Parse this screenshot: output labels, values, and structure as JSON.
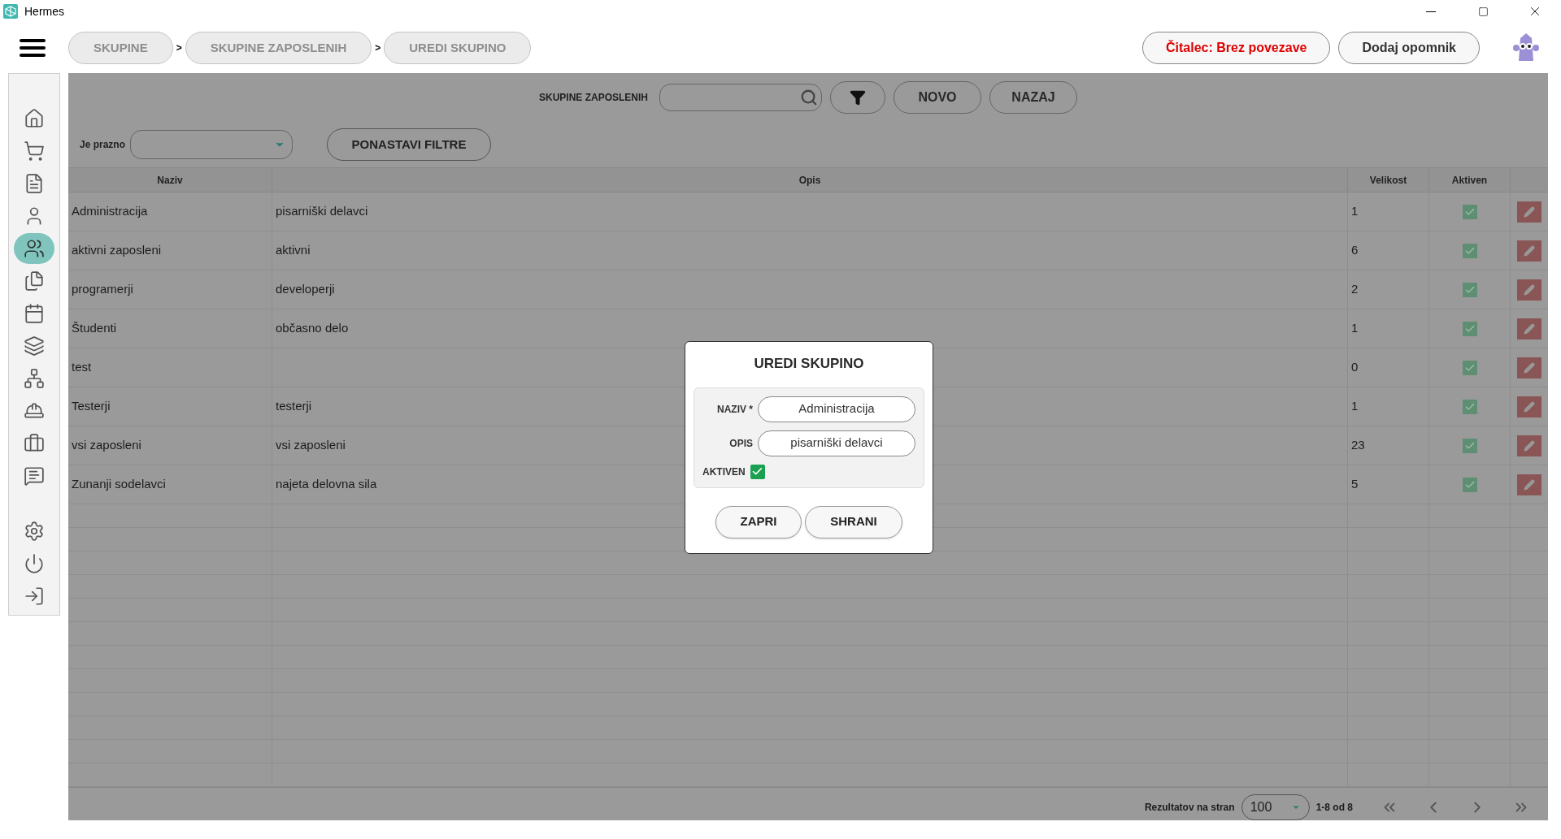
{
  "window": {
    "title": "Hermes"
  },
  "breadcrumbs": [
    {
      "label": "SKUPINE",
      "separator": ">"
    },
    {
      "label": "SKUPINE ZAPOSLENIH",
      "separator": ">"
    },
    {
      "label": "UREDI SKUPINO"
    }
  ],
  "header_buttons": [
    {
      "label": "Čitalec: Brez povezave",
      "kind": "warning"
    },
    {
      "label": "Dodaj opomnik",
      "kind": "normal"
    }
  ],
  "sidebar": {
    "items": [
      {
        "kind": "home",
        "selected": false
      },
      {
        "kind": "cart",
        "selected": false
      },
      {
        "kind": "document",
        "selected": false
      },
      {
        "kind": "person",
        "selected": false
      },
      {
        "kind": "people",
        "selected": true
      },
      {
        "kind": "pages",
        "selected": false
      },
      {
        "kind": "calendar",
        "selected": false
      },
      {
        "kind": "layers",
        "selected": false
      },
      {
        "kind": "hierarchy",
        "selected": false
      },
      {
        "kind": "worker",
        "selected": false
      },
      {
        "kind": "briefcase",
        "selected": false
      },
      {
        "kind": "message",
        "selected": false
      }
    ],
    "bottom_items": [
      {
        "kind": "settings",
        "selected": false
      },
      {
        "kind": "power",
        "selected": false
      },
      {
        "kind": "exit",
        "selected": false
      }
    ]
  },
  "toolbar": {
    "label": "SKUPINE ZAPOSLENIH",
    "buttons": [
      "NOVO",
      "NAZAJ"
    ]
  },
  "filters": {
    "label": "Je prazno",
    "reset_button": "PONASTAVI FILTRE"
  },
  "table": {
    "columns": [
      "Naziv",
      "Opis",
      "Velikost",
      "Aktiven"
    ],
    "rows": [
      {
        "naziv": "Administracija",
        "opis": "pisarniški delavci",
        "velikost": "1",
        "aktiven": true
      },
      {
        "naziv": "aktivni zaposleni",
        "opis": "aktivni",
        "velikost": "6",
        "aktiven": true
      },
      {
        "naziv": "programerji",
        "opis": "developerji",
        "velikost": "2",
        "aktiven": true
      },
      {
        "naziv": "Študenti",
        "opis": "občasno delo",
        "velikost": "1",
        "aktiven": true
      },
      {
        "naziv": "test",
        "opis": "",
        "velikost": "0",
        "aktiven": true
      },
      {
        "naziv": "Testerji",
        "opis": "testerji",
        "velikost": "1",
        "aktiven": true
      },
      {
        "naziv": "vsi zaposleni",
        "opis": "vsi zaposleni",
        "velikost": "23",
        "aktiven": true
      },
      {
        "naziv": "Zunanji sodelavci",
        "opis": "najeta delovna sila",
        "velikost": "5",
        "aktiven": true
      }
    ]
  },
  "pagination": {
    "label": "Rezultatov na stran",
    "page_size": "100",
    "range": "1-8 od 8"
  },
  "dialog": {
    "title": "UREDI SKUPINO",
    "fields": [
      {
        "label": "NAZIV *",
        "value": "Administracija"
      },
      {
        "label": "OPIS",
        "value": "pisarniški delavci"
      }
    ],
    "active": {
      "label": "AKTIVEN",
      "checked": true
    },
    "buttons": [
      "ZAPRI",
      "SHRANI"
    ]
  }
}
